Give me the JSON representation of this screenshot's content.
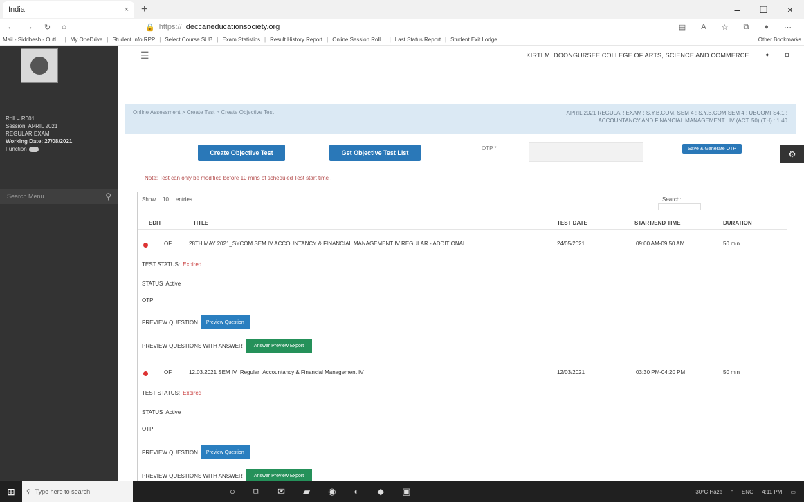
{
  "browser": {
    "tab_title": "India",
    "tab_close": "×",
    "new_tab": "+",
    "win_controls": [
      "–",
      "☐",
      "×"
    ],
    "nav": [
      "←",
      "→",
      "↻",
      "⌂"
    ],
    "url_prefix": "https://",
    "url_domain": "deccaneducationsociety.org",
    "bookmarks": [
      "Mail - Siddhesh - Outl...",
      "My OneDrive",
      "Student Info RPP",
      "Select Course SUB",
      "Exam Statistics",
      "Result History Report",
      "Online Session Roll...",
      "Last Status Report",
      "Student Exit Lodge"
    ],
    "other_bookmarks": "Other Bookmarks"
  },
  "sidebar": {
    "user_line1": "Roll = R001",
    "user_line2": "Session: APRIL 2021",
    "user_line3": "REGULAR EXAM",
    "working_date": "Working Date: 27/08/2021",
    "function_label": "Function",
    "search_placeholder": "Search Menu"
  },
  "topbar": {
    "college": "KIRTI M. DOONGURSEE COLLEGE OF ARTS, SCIENCE AND COMMERCE"
  },
  "breadcrumb": {
    "path": "Online Assessment > Create Test > Create Objective Test",
    "exam_line1": "APRIL 2021 REGULAR EXAM : S.Y.B.COM. SEM 4 : S.Y.B.COM SEM 4 : UBCOMFS4.1 :",
    "exam_line2": "ACCOUNTANCY AND FINANCIAL MANAGEMENT : IV (ACT. 50) (TH) : 1.40"
  },
  "actions": {
    "create_label": "Create Objective Test",
    "getlist_label": "Get Objective Test List",
    "otp_label": "OTP *",
    "small_btn_label": "Save & Generate OTP",
    "note": "Note: Test can only be modified before 10 mins of scheduled Test start time !"
  },
  "table": {
    "show_label": "Show",
    "show_value": "10",
    "entries_label": "entries",
    "search_label": "Search:",
    "headers": [
      "EDIT",
      "TITLE",
      "TEST DATE",
      "START/END TIME",
      "DURATION"
    ],
    "rows": [
      {
        "type": "OF",
        "title": "28TH MAY 2021_SYCOM SEM IV ACCOUNTANCY & FINANCIAL MANAGEMENT IV REGULAR - ADDITIONAL",
        "date": "24/05/2021",
        "time": "09:00 AM-09:50 AM",
        "duration": "50 min",
        "test_status_label": "TEST STATUS:",
        "test_status": "Expired",
        "status_label": "STATUS",
        "status": "Active",
        "otp_label": "OTP",
        "preview_label": "PREVIEW QUESTION",
        "preview_btn": "Preview Question",
        "answers_label": "PREVIEW QUESTIONS WITH ANSWER",
        "answers_btn": "Answer Preview Export"
      },
      {
        "type": "OF",
        "title": "12.03.2021 SEM IV_Regular_Accountancy & Financial Management IV",
        "date": "12/03/2021",
        "time": "03:30 PM-04:20 PM",
        "duration": "50 min",
        "test_status_label": "TEST STATUS:",
        "test_status": "Expired",
        "status_label": "STATUS",
        "status": "Active",
        "otp_label": "OTP",
        "preview_label": "PREVIEW QUESTION",
        "preview_btn": "Preview Question",
        "answers_label": "PREVIEW QUESTIONS WITH ANSWER",
        "answers_btn": "Answer Preview Export"
      }
    ]
  },
  "taskbar": {
    "search_placeholder": "Type here to search",
    "tray_weather": "30°C Haze",
    "tray_lang": "ENG",
    "tray_time": "4:11 PM"
  },
  "colors": {
    "sidebar_bg": "#333333",
    "primary_button": "#2a78b8",
    "success_button": "#25915a",
    "expired_text": "#c83b3b",
    "breadcrumb_bg": "#dbe9f4"
  }
}
